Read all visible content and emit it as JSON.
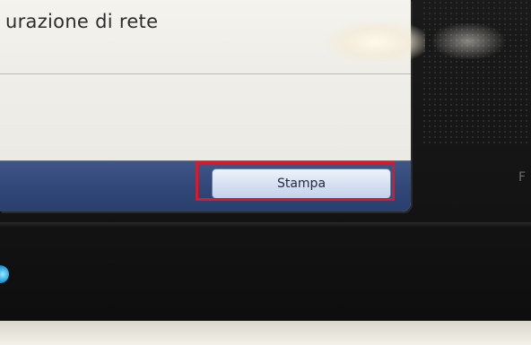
{
  "screen": {
    "title": "urazione di rete",
    "print_button_label": "Stampa"
  },
  "bezel": {
    "side_glyph": "F"
  },
  "colors": {
    "highlight": "#d81b2c",
    "bottom_bar": "#2f4677",
    "led": "#29a7e0"
  }
}
